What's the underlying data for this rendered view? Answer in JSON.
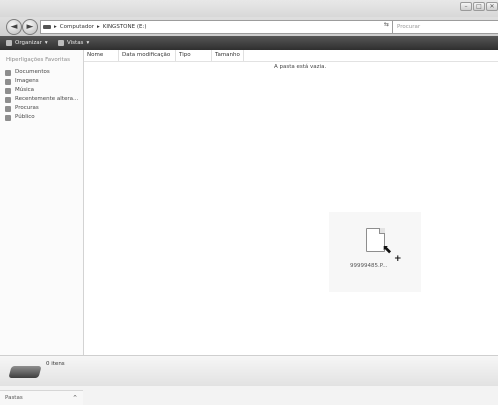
{
  "window": {
    "controls": [
      "–",
      "□",
      "✕"
    ]
  },
  "address": {
    "path": [
      "Computador",
      "KINGSTONE (E:)"
    ],
    "search_placeholder": "Procurar"
  },
  "toolbar": {
    "organize": "Organizar",
    "views": "Vistas"
  },
  "sidebar": {
    "heading": "Hiperligações Favoritas",
    "items": [
      {
        "label": "Documentos",
        "icon": "documents-icon"
      },
      {
        "label": "Imagens",
        "icon": "pictures-icon"
      },
      {
        "label": "Música",
        "icon": "music-icon"
      },
      {
        "label": "Recentemente altera...",
        "icon": "recent-icon"
      },
      {
        "label": "Procuras",
        "icon": "search-folder-icon"
      },
      {
        "label": "Público",
        "icon": "public-icon"
      }
    ],
    "folders_label": "Pastas"
  },
  "columns": [
    "Nome",
    "Data modificação",
    "Tipo",
    "Tamanho"
  ],
  "empty_message": "A pasta está vazia.",
  "drag": {
    "file_label": "99999485.P..."
  },
  "status": {
    "item_count": "0 itens"
  }
}
